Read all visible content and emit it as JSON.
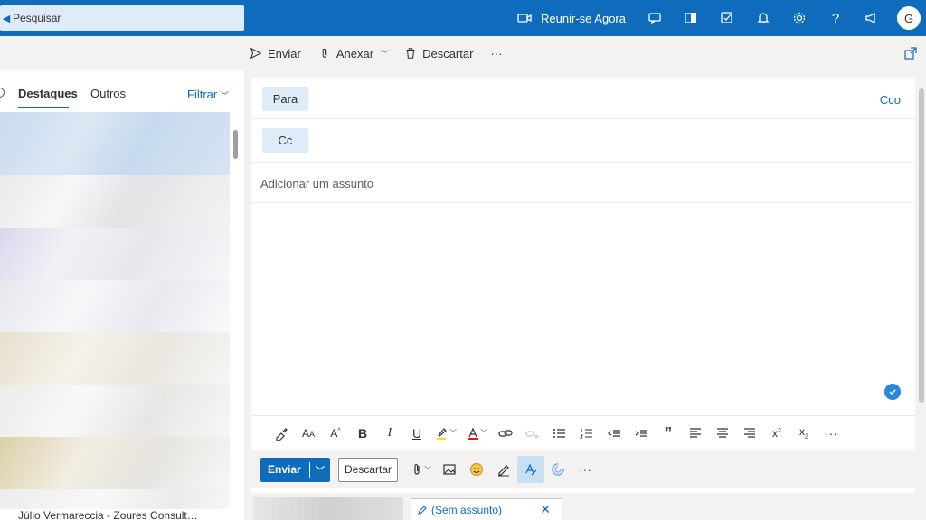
{
  "search": {
    "placeholder": "Pesquisar"
  },
  "topbar": {
    "meet_label": "Reunir-se Agora",
    "avatar_initial": "G",
    "icons": [
      "video-icon",
      "chat-icon",
      "office-icon",
      "tasks-icon",
      "bell-icon",
      "gear-icon",
      "help-icon",
      "feedback-icon"
    ]
  },
  "actionbar": {
    "send": "Enviar",
    "attach": "Anexar",
    "discard": "Descartar",
    "more": "···"
  },
  "leftpane": {
    "tabs": [
      "Destaques",
      "Outros"
    ],
    "filter": "Filtrar",
    "bottom_item": "Júlio Vermareccia - Zoures Consult…"
  },
  "compose": {
    "to_label": "Para",
    "cc_label": "Cc",
    "bcc_label": "Cco",
    "subject_placeholder": "Adicionar um assunto",
    "send_label": "Enviar",
    "discard_label": "Descartar"
  },
  "bottombar": {
    "draft_title": "(Sem assunto)"
  },
  "colors": {
    "brand": "#0f6cbd",
    "chip": "#deecf9"
  }
}
